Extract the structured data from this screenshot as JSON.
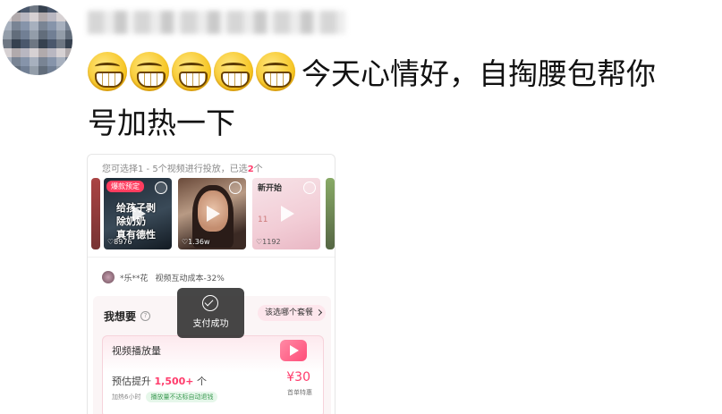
{
  "comment": {
    "text_line1": "今天心情好，自掏腰包帮你",
    "text_line2": "号加热一下",
    "emoji_icons": [
      "grinning-face-icon",
      "grinning-face-icon",
      "grinning-face-icon",
      "grinning-face-icon",
      "grinning-face-icon"
    ]
  },
  "card": {
    "hint_prefix": "您可选择1 - 5个视频进行投放，已选",
    "hint_count": "2",
    "hint_suffix": "个",
    "videos": [
      {
        "badge": "爆款预定",
        "overlay_line1": "给孩子剥",
        "overlay_line2": "除奶奶",
        "overlay_line3": "真有德性",
        "likes": "♡8976"
      },
      {
        "likes": "♡1.36w"
      },
      {
        "title": "新开始",
        "small": "11",
        "likes": "♡1192"
      }
    ],
    "promo_user": "*乐**花",
    "promo_text": "视频互动成本-32%",
    "want_label": "我想要",
    "pick_button": "该选哪个套餐",
    "option": {
      "title": "视频播放量",
      "est_prefix": "预估提升",
      "est_value": "1,500+",
      "est_suffix": "个",
      "price": "¥30",
      "first_order": "首单特惠",
      "time_note": "加热6小时",
      "tag": "播放量不达标自动退钱"
    }
  },
  "toast": {
    "text": "支付成功"
  },
  "colors": {
    "accent": "#ff3b6b",
    "toast_bg": "#282828"
  }
}
